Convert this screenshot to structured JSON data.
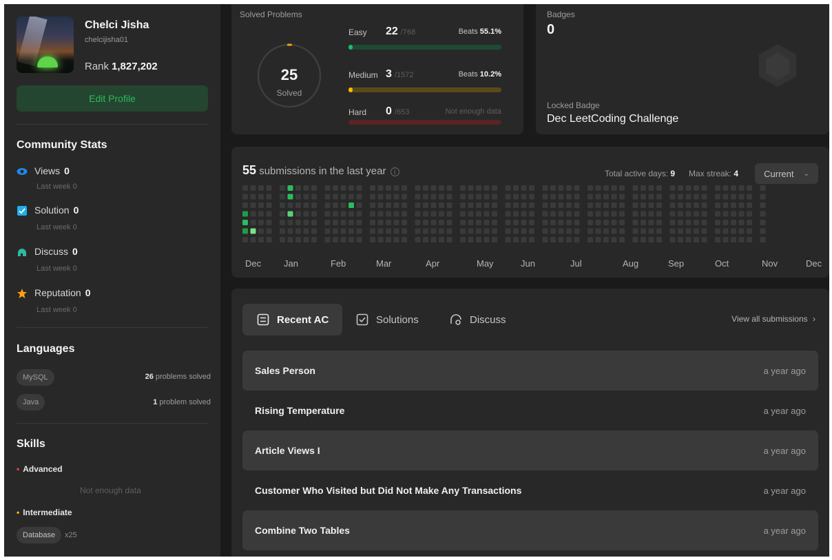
{
  "profile": {
    "name": "Chelci Jisha",
    "username": "chelcijisha01",
    "rank_label": "Rank",
    "rank_value": "1,827,202",
    "edit_button": "Edit Profile"
  },
  "community": {
    "title": "Community Stats",
    "stats": [
      {
        "icon": "eye-icon",
        "label": "Views",
        "value": "0",
        "sub": "Last week 0",
        "color": "#1e88e5"
      },
      {
        "icon": "check-square-icon",
        "label": "Solution",
        "value": "0",
        "sub": "Last week 0",
        "color": "#1fb0e8"
      },
      {
        "icon": "discuss-icon",
        "label": "Discuss",
        "value": "0",
        "sub": "Last week 0",
        "color": "#2cbb9d"
      },
      {
        "icon": "star-icon",
        "label": "Reputation",
        "value": "0",
        "sub": "Last week 0",
        "color": "#ffa116"
      }
    ]
  },
  "languages": {
    "title": "Languages",
    "items": [
      {
        "name": "MySQL",
        "count": "26",
        "suffix": "problems solved"
      },
      {
        "name": "Java",
        "count": "1",
        "suffix": "problem solved"
      }
    ]
  },
  "skills": {
    "title": "Skills",
    "advanced": {
      "label": "Advanced",
      "empty": "Not enough data"
    },
    "intermediate": {
      "label": "Intermediate",
      "tag": "Database",
      "count": "x25"
    }
  },
  "solved": {
    "title": "Solved Problems",
    "total": "25",
    "total_label": "Solved",
    "difficulties": [
      {
        "label": "Easy",
        "solved": "22",
        "total": "/768",
        "beats_label": "Beats",
        "beats": "55.1%",
        "progress": 0.029,
        "color": "#1cbb6e",
        "track": "#1e4a33"
      },
      {
        "label": "Medium",
        "solved": "3",
        "total": "/1572",
        "beats_label": "Beats",
        "beats": "10.2%",
        "progress": 0.002,
        "color": "#ffb800",
        "track": "#5a4a1a"
      },
      {
        "label": "Hard",
        "solved": "0",
        "total": "/653",
        "beats_label": "",
        "beats": "Not enough data",
        "progress": 0,
        "color": "#ef4743",
        "track": "#5a2424"
      }
    ]
  },
  "badges": {
    "title": "Badges",
    "count": "0",
    "locked_label": "Locked Badge",
    "locked_name": "Dec LeetCoding Challenge"
  },
  "submissions": {
    "count": "55",
    "text": "submissions in the last year",
    "active_days_label": "Total active days:",
    "active_days": "9",
    "max_streak_label": "Max streak:",
    "max_streak": "4",
    "dropdown": "Current",
    "months": [
      "Dec",
      "Jan",
      "Feb",
      "Mar",
      "Apr",
      "May",
      "Jun",
      "Jul",
      "Aug",
      "Sep",
      "Oct",
      "Nov",
      "Dec"
    ]
  },
  "tabs": [
    {
      "icon": "list-icon",
      "label": "Recent AC"
    },
    {
      "icon": "check-square-icon",
      "label": "Solutions"
    },
    {
      "icon": "discuss-icon",
      "label": "Discuss"
    }
  ],
  "view_all": "View all submissions",
  "recent": [
    {
      "title": "Sales Person",
      "time": "a year ago"
    },
    {
      "title": "Rising Temperature",
      "time": "a year ago"
    },
    {
      "title": "Article Views I",
      "time": "a year ago"
    },
    {
      "title": "Customer Who Visited but Did Not Make Any Transactions",
      "time": "a year ago"
    },
    {
      "title": "Combine Two Tables",
      "time": "a year ago"
    }
  ],
  "colors": {
    "accent_green": "#2cbb5d",
    "easy": "#1cbb6e",
    "medium": "#ffb800",
    "hard": "#ef4743"
  }
}
